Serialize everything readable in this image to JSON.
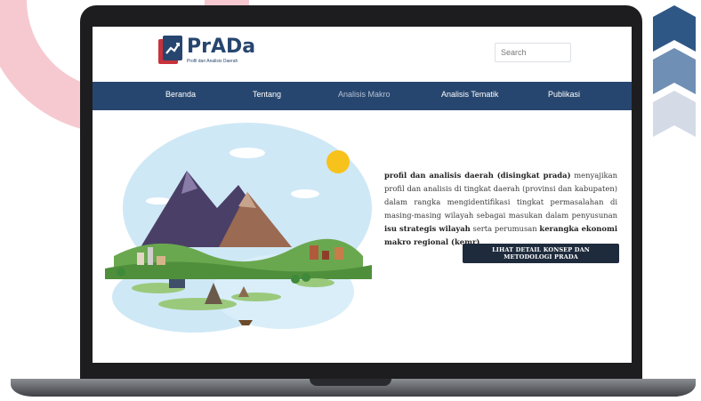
{
  "site": {
    "logo_title": "PrADa",
    "logo_subtitle": "Profil dan Analisis Daerah",
    "search_placeholder": "Search"
  },
  "nav": [
    {
      "label": "Beranda",
      "active": false
    },
    {
      "label": "Tentang",
      "active": false
    },
    {
      "label": "Analisis Makro",
      "active": true
    },
    {
      "label": "Analisis Tematik",
      "active": false
    },
    {
      "label": "Publikasi",
      "active": false
    }
  ],
  "hero": {
    "t1": "profil dan analisis daerah (disingkat prada)",
    "t2": " menyajikan profil dan analisis di tingkat daerah (provinsi dan kabupaten) dalam rangka mengidentifikasi tingkat permasalahan di masing-masing wilayah sebagai masukan dalam penyusunan ",
    "t3": "isu strategis wilayah",
    "t4": " serta perumusan ",
    "t5": "kerangka ekonomi makro regional (kemr)",
    "t6": ".",
    "cta_label": "LIHAT DETAIL KONSEP DAN METODOLOGI PRADA"
  },
  "icons": {
    "logo": "prada-logo-icon",
    "illustration": "landscape-illustration-icon",
    "chevrons": "chevron-stack-icon"
  },
  "colors": {
    "navy": "#27466f",
    "cta": "#1e2b3c",
    "pink": "#f6c9d0",
    "chevron_dark": "#2e5786",
    "chevron_mid": "#6f8fb4",
    "chevron_light": "#d4dbe6"
  }
}
